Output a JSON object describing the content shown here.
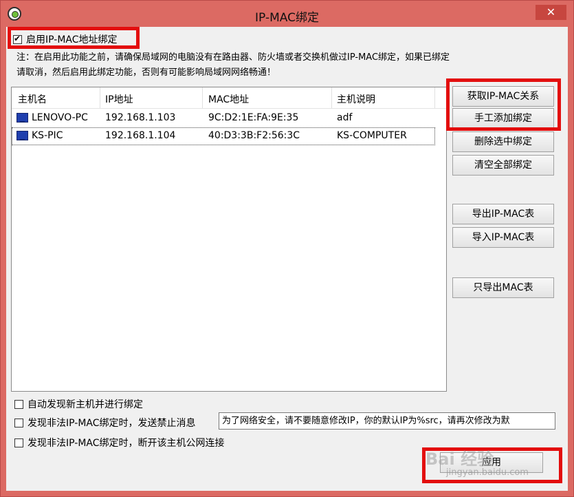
{
  "window": {
    "title": "IP-MAC绑定",
    "close_glyph": "✕"
  },
  "enable_binding": {
    "label": "启用IP-MAC地址绑定",
    "checked": true
  },
  "note": "注：在启用此功能之前，请确保局域网的电脑没有在路由器、防火墙或者交换机做过IP-MAC绑定，如果已绑定请取消，然后启用此绑定功能，否则有可能影响局域网网络畅通！",
  "table": {
    "columns": [
      "主机名",
      "IP地址",
      "MAC地址",
      "主机说明"
    ],
    "rows": [
      {
        "host": "LENOVO-PC",
        "ip": "192.168.1.103",
        "mac": "9C:D2:1E:FA:9E:35",
        "desc": "adf",
        "icon": "computer-icon"
      },
      {
        "host": "KS-PIC",
        "ip": "192.168.1.104",
        "mac": "40:D3:3B:F2:56:3C",
        "desc": "KS-COMPUTER",
        "icon": "computer-icon"
      }
    ]
  },
  "buttons": {
    "get_relation": "获取IP-MAC关系",
    "manual_add": "手工添加绑定",
    "delete_selected": "删除选中绑定",
    "clear_all": "清空全部绑定",
    "export_table": "导出IP-MAC表",
    "import_table": "导入IP-MAC表",
    "export_mac_only": "只导出MAC表",
    "apply": "应用"
  },
  "options": {
    "auto_bind": {
      "label": "自动发现新主机并进行绑定",
      "checked": false
    },
    "send_block_msg": {
      "label": "发现非法IP-MAC绑定时，发送禁止消息",
      "checked": false
    },
    "block_msg_value": "为了网络安全，请不要随意修改IP，你的默认IP为%src，请再次修改为默",
    "disconnect": {
      "label": "发现非法IP-MAC绑定时，断开该主机公网连接",
      "checked": false
    }
  },
  "watermark": {
    "text": "Bai 经验",
    "url": "jingyan.baidu.com"
  },
  "colors": {
    "titlebar": "#dc6a63",
    "highlight": "#e30d0d",
    "host_icon": "#1f3fae"
  }
}
